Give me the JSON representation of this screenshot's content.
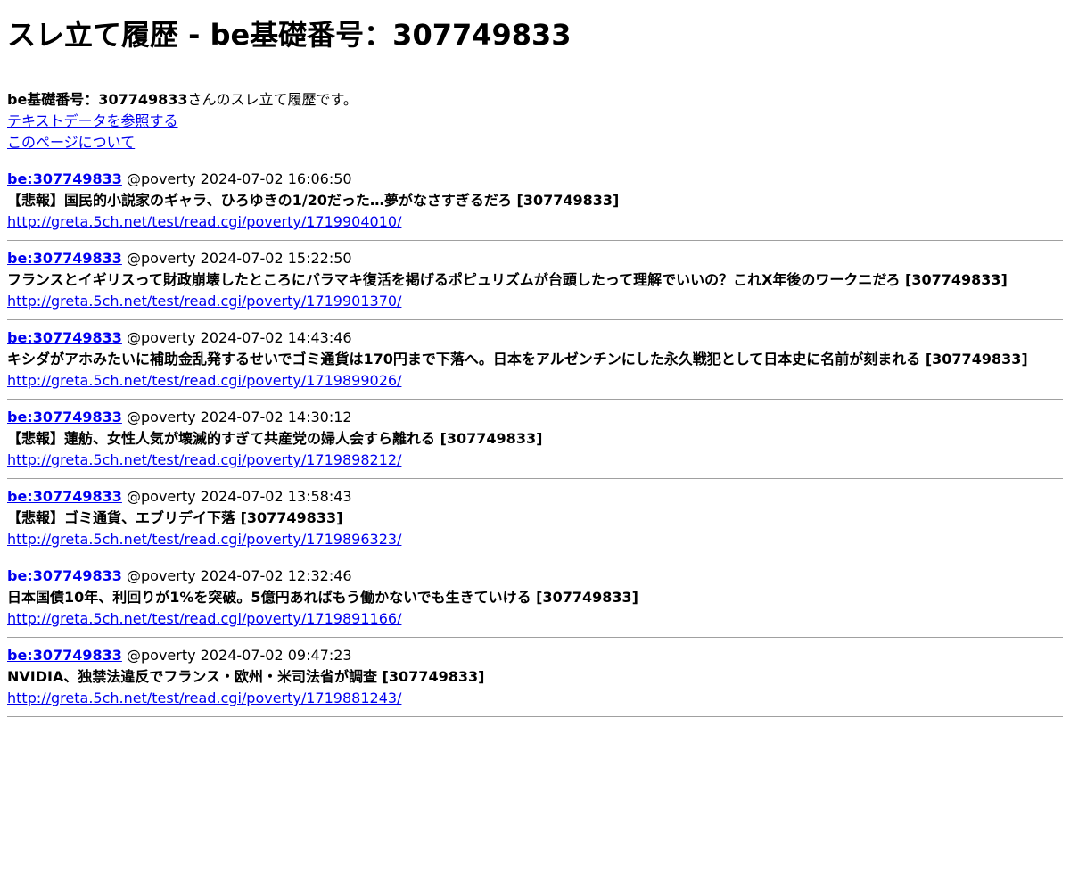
{
  "page": {
    "heading": "スレ立て履歴 - be基礎番号：307749833"
  },
  "intro": {
    "be_label": "be基礎番号：307749833",
    "be_suffix": "さんのスレ立て履歴です。",
    "text_data_link": "テキストデータを参照する",
    "about_link": "このページについて"
  },
  "threads": [
    {
      "be": "be:307749833",
      "meta": " @poverty 2024-07-02 16:06:50",
      "title": "【悲報】国民的小説家のギャラ、ひろゆきの1/20だった…夢がなさすぎるだろ [307749833]",
      "url": "http://greta.5ch.net/test/read.cgi/poverty/1719904010/"
    },
    {
      "be": "be:307749833",
      "meta": " @poverty 2024-07-02 15:22:50",
      "title": "フランスとイギリスって財政崩壊したところにバラマキ復活を掲げるポピュリズムが台頭したって理解でいいの？これX年後のワークニだろ [307749833]",
      "url": "http://greta.5ch.net/test/read.cgi/poverty/1719901370/"
    },
    {
      "be": "be:307749833",
      "meta": " @poverty 2024-07-02 14:43:46",
      "title": "キシダがアホみたいに補助金乱発するせいでゴミ通貨は170円まで下落へ。日本をアルゼンチンにした永久戦犯として日本史に名前が刻まれる [307749833]",
      "url": "http://greta.5ch.net/test/read.cgi/poverty/1719899026/"
    },
    {
      "be": "be:307749833",
      "meta": " @poverty 2024-07-02 14:30:12",
      "title": "【悲報】蓮舫、女性人気が壊滅的すぎて共産党の婦人会すら離れる [307749833]",
      "url": "http://greta.5ch.net/test/read.cgi/poverty/1719898212/"
    },
    {
      "be": "be:307749833",
      "meta": " @poverty 2024-07-02 13:58:43",
      "title": "【悲報】ゴミ通貨、エブリデイ下落 [307749833]",
      "url": "http://greta.5ch.net/test/read.cgi/poverty/1719896323/"
    },
    {
      "be": "be:307749833",
      "meta": " @poverty 2024-07-02 12:32:46",
      "title": "日本国債10年、利回りが1%を突破。5億円あればもう働かないでも生きていける [307749833]",
      "url": "http://greta.5ch.net/test/read.cgi/poverty/1719891166/"
    },
    {
      "be": "be:307749833",
      "meta": " @poverty 2024-07-02 09:47:23",
      "title": "NVIDIA、独禁法違反でフランス・欧州・米司法省が調査 [307749833]",
      "url": "http://greta.5ch.net/test/read.cgi/poverty/1719881243/"
    }
  ]
}
